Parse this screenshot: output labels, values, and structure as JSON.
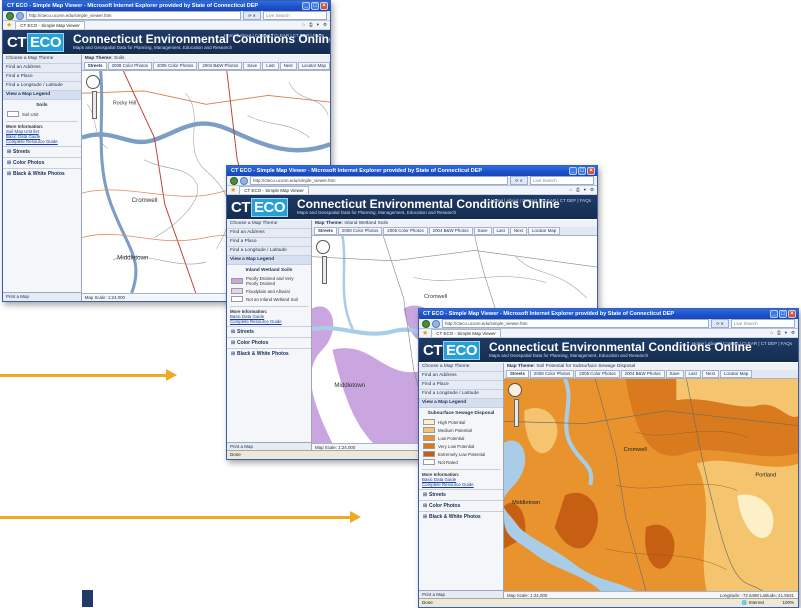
{
  "colors": {
    "titlebar": "#1d4fc7",
    "banner": "#1f3b66",
    "eco_badge": "#27a0d6",
    "arrow": "#f2a922",
    "wetland": "#c9a6e0",
    "drainage_high": "#c75f12",
    "drainage_mid": "#e8932e",
    "drainage_low": "#f5c46e",
    "water": "#a9cde6"
  },
  "window1": {
    "title": "CT ECO - Simple Map Viewer - Microsoft Internet Explorer provided by State of Connecticut DEP",
    "address": "http://cteco.uconn.edu/simple_viewer.htm",
    "search_placeholder": "Live Search",
    "tab_label": "CT ECO - Simple Map Viewer",
    "logo_ct": "CT",
    "logo_eco": "ECO",
    "site_title": "Connecticut Environmental Conditions Online",
    "site_subtitle": "Maps and Geospatial Data for Planning, Management, Education and Research",
    "site_nav": "Home | About | Contact | CLEAR | CT DEP | FAQs",
    "sidebar": {
      "links": [
        "Choose a Map Theme",
        "Find an Address",
        "Find a Place",
        "Find a Longitude / Latitude",
        "View a Map Legend"
      ],
      "legend_title": "Soils",
      "legend_items": [
        "Soil Unit"
      ],
      "more_info_title": "More Information:",
      "more_info_links": [
        "Soil Map Unit list",
        "Basic Data Guide",
        "Complete Resource Guide"
      ],
      "expanders": [
        "Streets",
        "Color Photos",
        "Black & White Photos"
      ],
      "print": "Print a Map"
    },
    "map_theme_label": "Map Theme:",
    "map_theme_value": "Soils",
    "map_tabs": [
      "Streets",
      "2008 Color Photos",
      "2005 Color Photos",
      "2004 B&W Photos",
      "Save",
      "Last",
      "Next",
      "Locator Map"
    ],
    "scale_text": "Map Scale: 1:24,000",
    "place_labels": [
      "Cromwell",
      "Middletown",
      "Rocky Hill"
    ]
  },
  "window2": {
    "title": "CT ECO - Simple Map Viewer - Microsoft Internet Explorer provided by State of Connecticut DEP",
    "address": "http://cteco.uconn.edu/simple_viewer.htm",
    "search_placeholder": "Live Search",
    "tab_label": "CT ECO - Simple Map Viewer",
    "logo_ct": "CT",
    "logo_eco": "ECO",
    "site_title": "Connecticut Environmental Conditions Online",
    "site_subtitle": "Maps and Geospatial Data for Planning, Management, Education and Research",
    "site_nav": "Home | About | Contact | CLEAR | CT DEP | FAQs",
    "sidebar": {
      "links": [
        "Choose a Map Theme",
        "Find an Address",
        "Find a Place",
        "Find a Longitude / Latitude",
        "View a Map Legend"
      ],
      "legend_title": "Inland Wetland Soils",
      "legend_items": [
        "Poorly Drained and Very Poorly Drained",
        "Floodplain and Alluvial",
        "Not an Inland Wetland Soil"
      ],
      "more_info_title": "More Information:",
      "more_info_links": [
        "Basic Data Guide",
        "Complete Resource Guide"
      ],
      "expanders": [
        "Streets",
        "Color Photos",
        "Black & White Photos"
      ],
      "print": "Print a Map"
    },
    "map_theme_label": "Map Theme:",
    "map_theme_value": "Inland Wetland Soils",
    "map_tabs": [
      "Streets",
      "2008 Color Photos",
      "2005 Color Photos",
      "2004 B&W Photos",
      "Save",
      "Last",
      "Next",
      "Locator Map"
    ],
    "scale_text": "Map Scale: 1:24,000",
    "status_text": "Done",
    "place_labels": [
      "Middletown",
      "Cromwell"
    ]
  },
  "window3": {
    "title": "CT ECO - Simple Map Viewer - Microsoft Internet Explorer provided by State of Connecticut DEP",
    "address": "http://cteco.uconn.edu/simple_viewer.htm",
    "search_placeholder": "Live Search",
    "tab_label": "CT ECO - Simple Map Viewer",
    "logo_ct": "CT",
    "logo_eco": "ECO",
    "site_title": "Connecticut Environmental Conditions Online",
    "site_subtitle": "Maps and Geospatial Data for Planning, Management, Education and Research",
    "site_nav": "Home | About | Contact | CLEAR | CT DEP | FAQs",
    "sidebar": {
      "links": [
        "Choose a Map Theme",
        "Find an Address",
        "Find a Place",
        "Find a Longitude / Latitude",
        "View a Map Legend"
      ],
      "legend_title": "Subsurface Sewage Disposal",
      "legend_items": [
        "High Potential",
        "Medium Potential",
        "Low Potential",
        "Very Low Potential",
        "Extremely Low Potential",
        "Not Rated"
      ],
      "more_info_title": "More Information:",
      "more_info_links": [
        "Basic Data Guide",
        "Complete Resource Guide"
      ],
      "expanders": [
        "Streets",
        "Color Photos",
        "Black & White Photos"
      ],
      "print": "Print a Map"
    },
    "map_theme_label": "Map Theme:",
    "map_theme_value": "Soil Potential for Subsurface Sewage Disposal",
    "map_tabs": [
      "Streets",
      "2008 Color Photos",
      "2005 Color Photos",
      "2004 B&W Photos",
      "Save",
      "Last",
      "Next",
      "Locator Map"
    ],
    "scale_text": "Map Scale: 1:24,000",
    "coords_text": "Longitude: -72.6468 Latitude: 41.5531",
    "status_text": "Done",
    "status_zone": "Internet",
    "zoom": "100%",
    "place_labels": [
      "Middletown",
      "Cromwell",
      "Portland"
    ]
  }
}
